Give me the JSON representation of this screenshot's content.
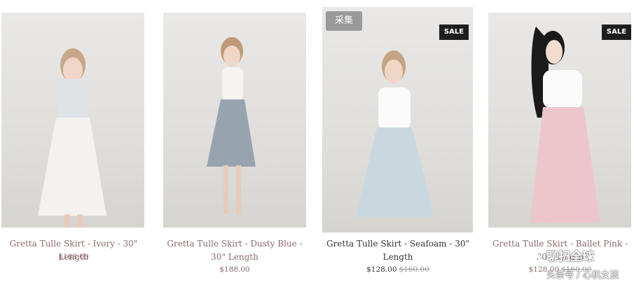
{
  "products": [
    {
      "title": "Gretta Tulle Skirt - Ivory - 30\" Length",
      "price": "$188.00",
      "old_price": "",
      "sale_label": "",
      "skirt_color": "#f4f2ee",
      "top_color": "#dfe3e6"
    },
    {
      "title": "Gretta Tulle Skirt - Dusty Blue - 30\" Length",
      "price": "$188.00",
      "old_price": "",
      "sale_label": "",
      "skirt_color": "#98a3b0",
      "top_color": "#f6f4f2"
    },
    {
      "title": "Gretta Tulle Skirt - Seafoam - 30\" Length",
      "price": "$128.00",
      "old_price": "$160.00",
      "sale_label": "SALE",
      "skirt_color": "#c9d8df",
      "top_color": "#fbfbfb"
    },
    {
      "title": "Gretta Tulle Skirt - Ballet Pink - 30\" Length",
      "price": "$128.00",
      "old_price": "$160.00",
      "sale_label": "SALE",
      "skirt_color": "#ecc6cb",
      "top_color": "#fbfbfb"
    }
  ],
  "collect_button": "采集",
  "watermark": {
    "line1": "聊扫全球",
    "line2": "头条号 / 心机女孩"
  }
}
